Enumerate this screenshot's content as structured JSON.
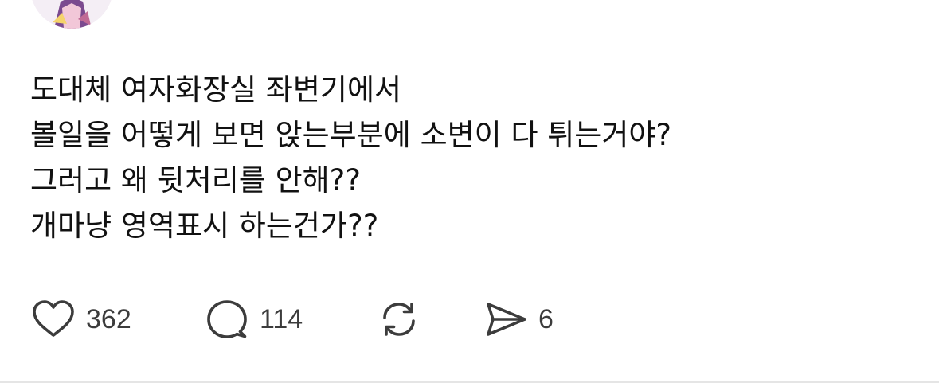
{
  "post": {
    "author": {
      "avatar_icon": "avatar-image"
    },
    "text_lines": [
      "도대체 여자화장실 좌변기에서",
      "볼일을 어떻게 보면 앉는부분에 소변이 다 튀는거야?",
      "그러고 왜 뒷처리를 안해??",
      "개마냥 영역표시 하는건가??"
    ]
  },
  "actions": {
    "like": {
      "icon": "heart-icon",
      "count": "362"
    },
    "reply": {
      "icon": "speech-bubble-icon",
      "count": "114"
    },
    "repost": {
      "icon": "repost-icon"
    },
    "share": {
      "icon": "send-icon",
      "count": "6"
    }
  },
  "colors": {
    "text": "#111111",
    "icon": "#3c3c3c",
    "divider": "#e5e5e5"
  }
}
